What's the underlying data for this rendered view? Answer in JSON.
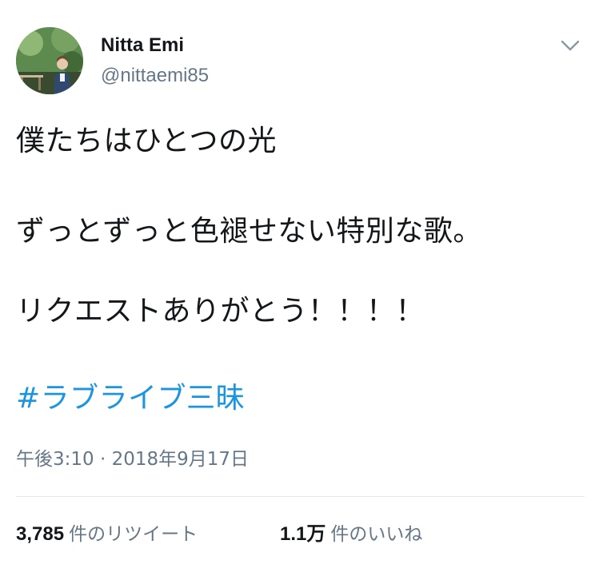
{
  "user": {
    "display_name": "Nitta Emi",
    "handle": "@nittaemi85"
  },
  "tweet": {
    "lines": [
      "僕たちはひとつの光",
      "ずっとずっと色褪せない特別な歌。",
      "リクエストありがとう！！！！"
    ],
    "hashtag": "#ラブライブ三昧",
    "timestamp": "午後3:10 · 2018年9月17日"
  },
  "stats": {
    "retweets_count": "3,785",
    "retweets_label": "件のリツイート",
    "likes_count": "1.1万",
    "likes_label": "件のいいね"
  },
  "icons": {
    "menu": "chevron-down-icon"
  },
  "colors": {
    "text": "#14171a",
    "secondary": "#657786",
    "link": "#1b95e0",
    "divider": "#e1e8ed"
  }
}
